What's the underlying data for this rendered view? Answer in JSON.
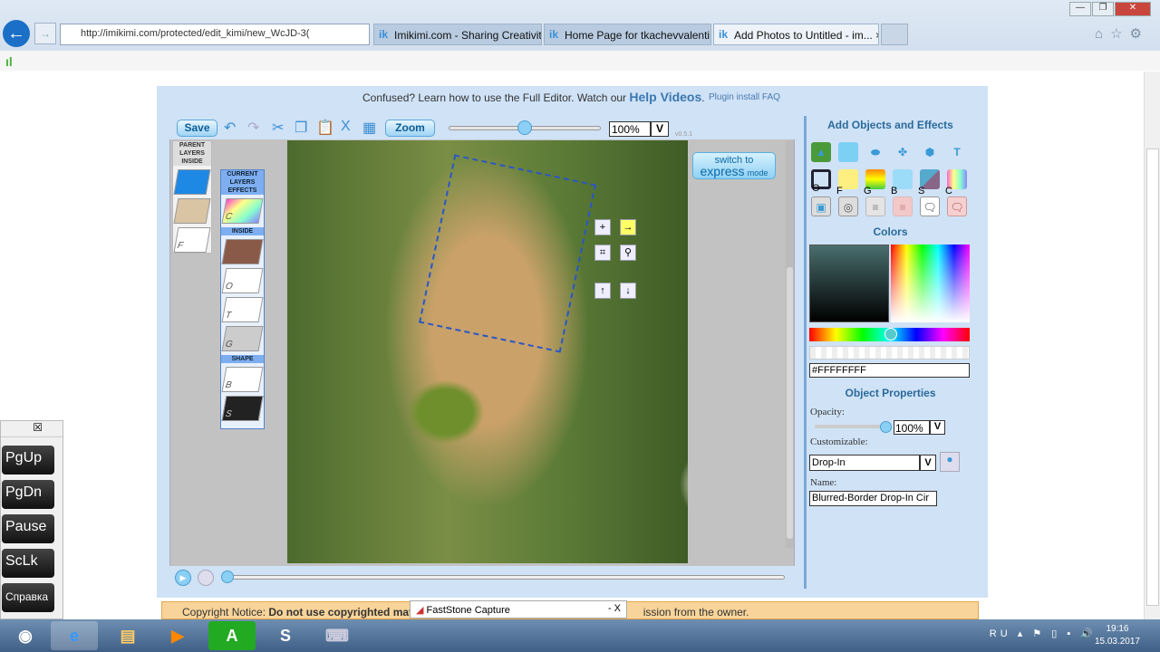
{
  "browser": {
    "url": "http://imikimi.com/protected/edit_kimi/new_WcJD-3(",
    "tabs": [
      {
        "label": "Imikimi.com - Sharing Creativity"
      },
      {
        "label": "Home Page for tkachevvalenti..."
      },
      {
        "label": "Add Photos to Untitled - im..."
      }
    ],
    "close_tab": "×"
  },
  "header": {
    "help_text": "Confused? Learn how to use the Full Editor. Watch our ",
    "help_link": "Help Videos",
    "help_end": ".",
    "faq": "Plugin install FAQ"
  },
  "toolbar": {
    "save": "Save",
    "zoom": "Zoom",
    "zoom_value": "100%",
    "dropdown": "V",
    "version": "v0.5.1",
    "zoom_level_percent": 50
  },
  "switch": {
    "line1": "switch to",
    "line2": "express",
    "line3": "mode"
  },
  "parent_layers": {
    "title": "PARENT LAYERS",
    "inside": "INSIDE",
    "items": [
      "F"
    ]
  },
  "current_layers": {
    "title": "CURRENT LAYERS",
    "effects": "EFFECTS",
    "effects_items": [
      "C"
    ],
    "inside": "INSIDE",
    "inside_items": [
      "O",
      "T",
      "G"
    ],
    "shape": "SHAPE",
    "shape_items": [
      "B",
      "S"
    ]
  },
  "objects": {
    "title": "Add Objects and Effects",
    "row2_labels": [
      "O",
      "F",
      "G",
      "B",
      "S",
      "C"
    ]
  },
  "colors": {
    "title": "Colors",
    "hex": "#FFFFFFFF"
  },
  "properties": {
    "title": "Object Properties",
    "opacity_label": "Opacity:",
    "opacity": "100%",
    "dropdown": "V",
    "customizable_label": "Customizable:",
    "customizable": "Drop-In",
    "name_label": "Name:",
    "name": "Blurred-Border Drop-In Cir"
  },
  "copyright": {
    "prefix": "Copyright Notice: ",
    "bold": "Do not use copyrighted materi",
    "suffix": "ission from the owner."
  },
  "faststone": {
    "title": "FastStone Capture",
    "controls": "-  X"
  },
  "keys": {
    "close": "☒",
    "items": [
      "PgUp",
      "PgDn",
      "Pause",
      "ScLk",
      "Справка"
    ]
  },
  "taskbar": {
    "lang": "RU",
    "time": "19:16",
    "date": "15.03.2017"
  }
}
